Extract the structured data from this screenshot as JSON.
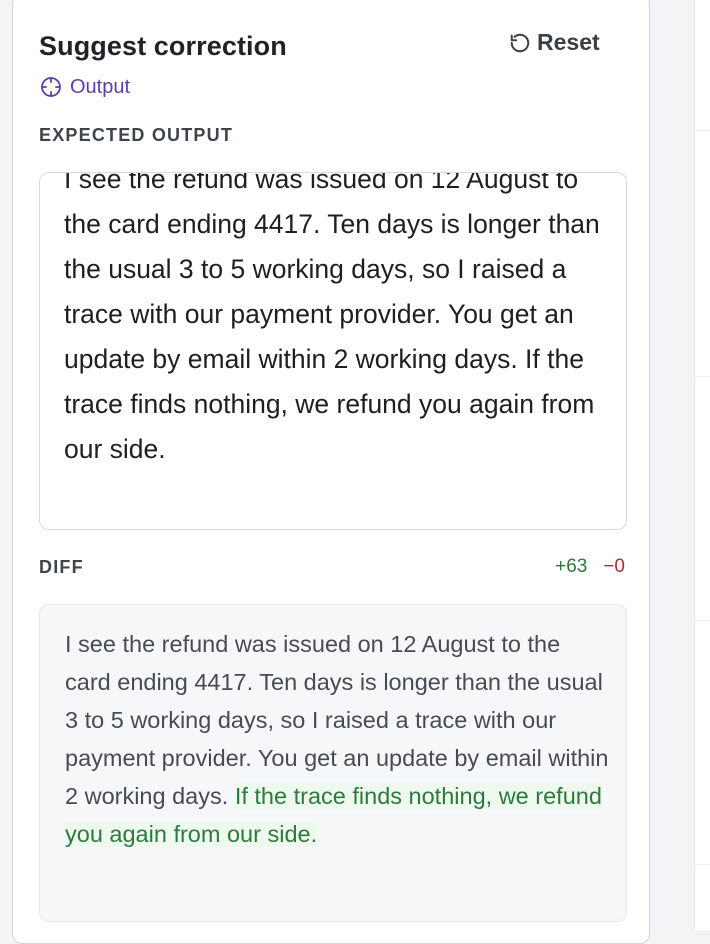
{
  "panel": {
    "title": "Suggest correction",
    "reset_label": "Reset",
    "output_tag": "Output"
  },
  "expected": {
    "label": "EXPECTED OUTPUT",
    "text": "I see the refund was issued on 12 August to the card ending 4417. Ten days is longer than the usual 3 to 5 working days, so I raised a trace with our payment provider. You get an update by email within 2 working days. If the trace finds nothing, we refund you again from our side."
  },
  "diff": {
    "label": "DIFF",
    "additions": "+63",
    "deletions": "−0",
    "unchanged_text": "I see the refund was issued on 12 August to the card ending 4417. Ten days is longer than the usual 3 to 5 working days, so I raised a trace with our payment provider. You get an update by email within 2 working days. ",
    "added_text": "If the trace finds nothing, we refund you again from our side."
  },
  "icons": {
    "reset": "rotate-ccw-icon",
    "output": "crosshair-icon"
  },
  "colors": {
    "accent_purple": "#5b3fa8",
    "diff_add": "#2f7a3a",
    "diff_del": "#a6302c",
    "diff_add_bg": "#eef8ef"
  }
}
